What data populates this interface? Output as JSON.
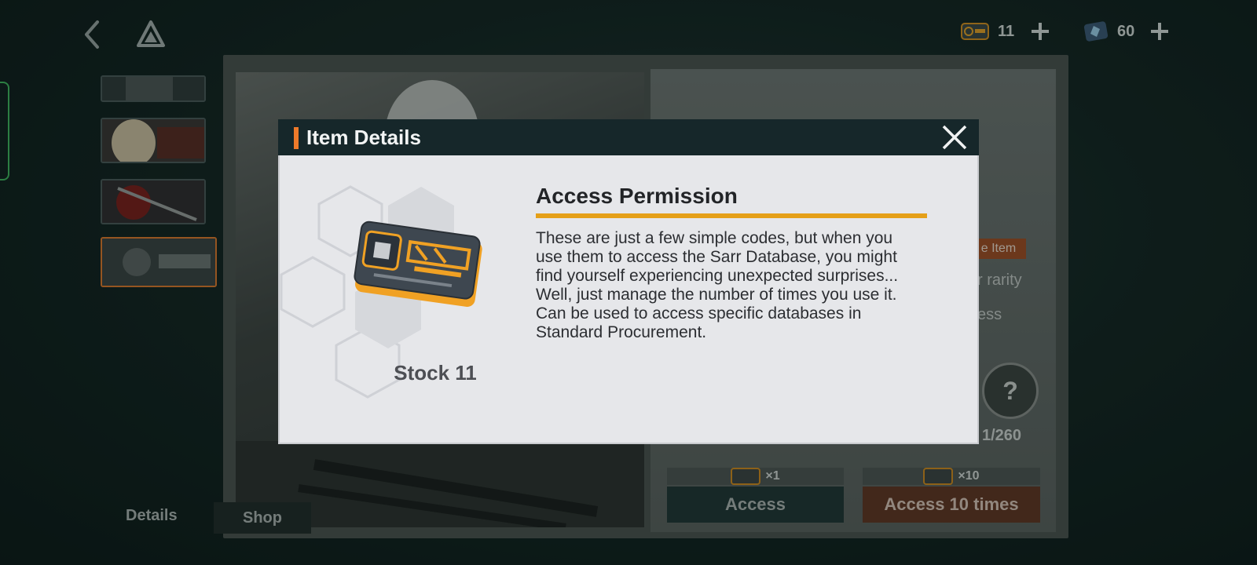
{
  "topbar": {
    "back_icon": "chevron-left-icon",
    "logo_icon": "drive-triangle-logo",
    "currencies": [
      {
        "icon": "access-permission-ticket-icon",
        "value": "11"
      },
      {
        "icon": "crystal-currency-icon",
        "value": "60"
      }
    ]
  },
  "background": {
    "tag_text": "e Item",
    "text_rarity": "r rarity",
    "text_access": "ess",
    "avatar_glyph": "?",
    "progress": "1/260",
    "cost_single": "×1",
    "cost_ten": "×10",
    "access_label": "Access",
    "access10_label": "Access 10 times",
    "tabs": {
      "details": "Details",
      "shop": "Shop"
    }
  },
  "modal": {
    "title": "Item Details",
    "item_name": "Access Permission",
    "description": "These are just a few simple codes, but when you\nuse them to access the Sarr Database, you might\nfind yourself experiencing unexpected surprises...\nWell, just manage the number of times you use it.\nCan be used to access specific databases in\nStandard Procurement.",
    "stock": "Stock 11"
  },
  "colors": {
    "accent_orange": "#ee7a2a",
    "underline_gold": "#e5a018",
    "header_dark": "#16272a",
    "body_light": "#e6e7ea"
  }
}
